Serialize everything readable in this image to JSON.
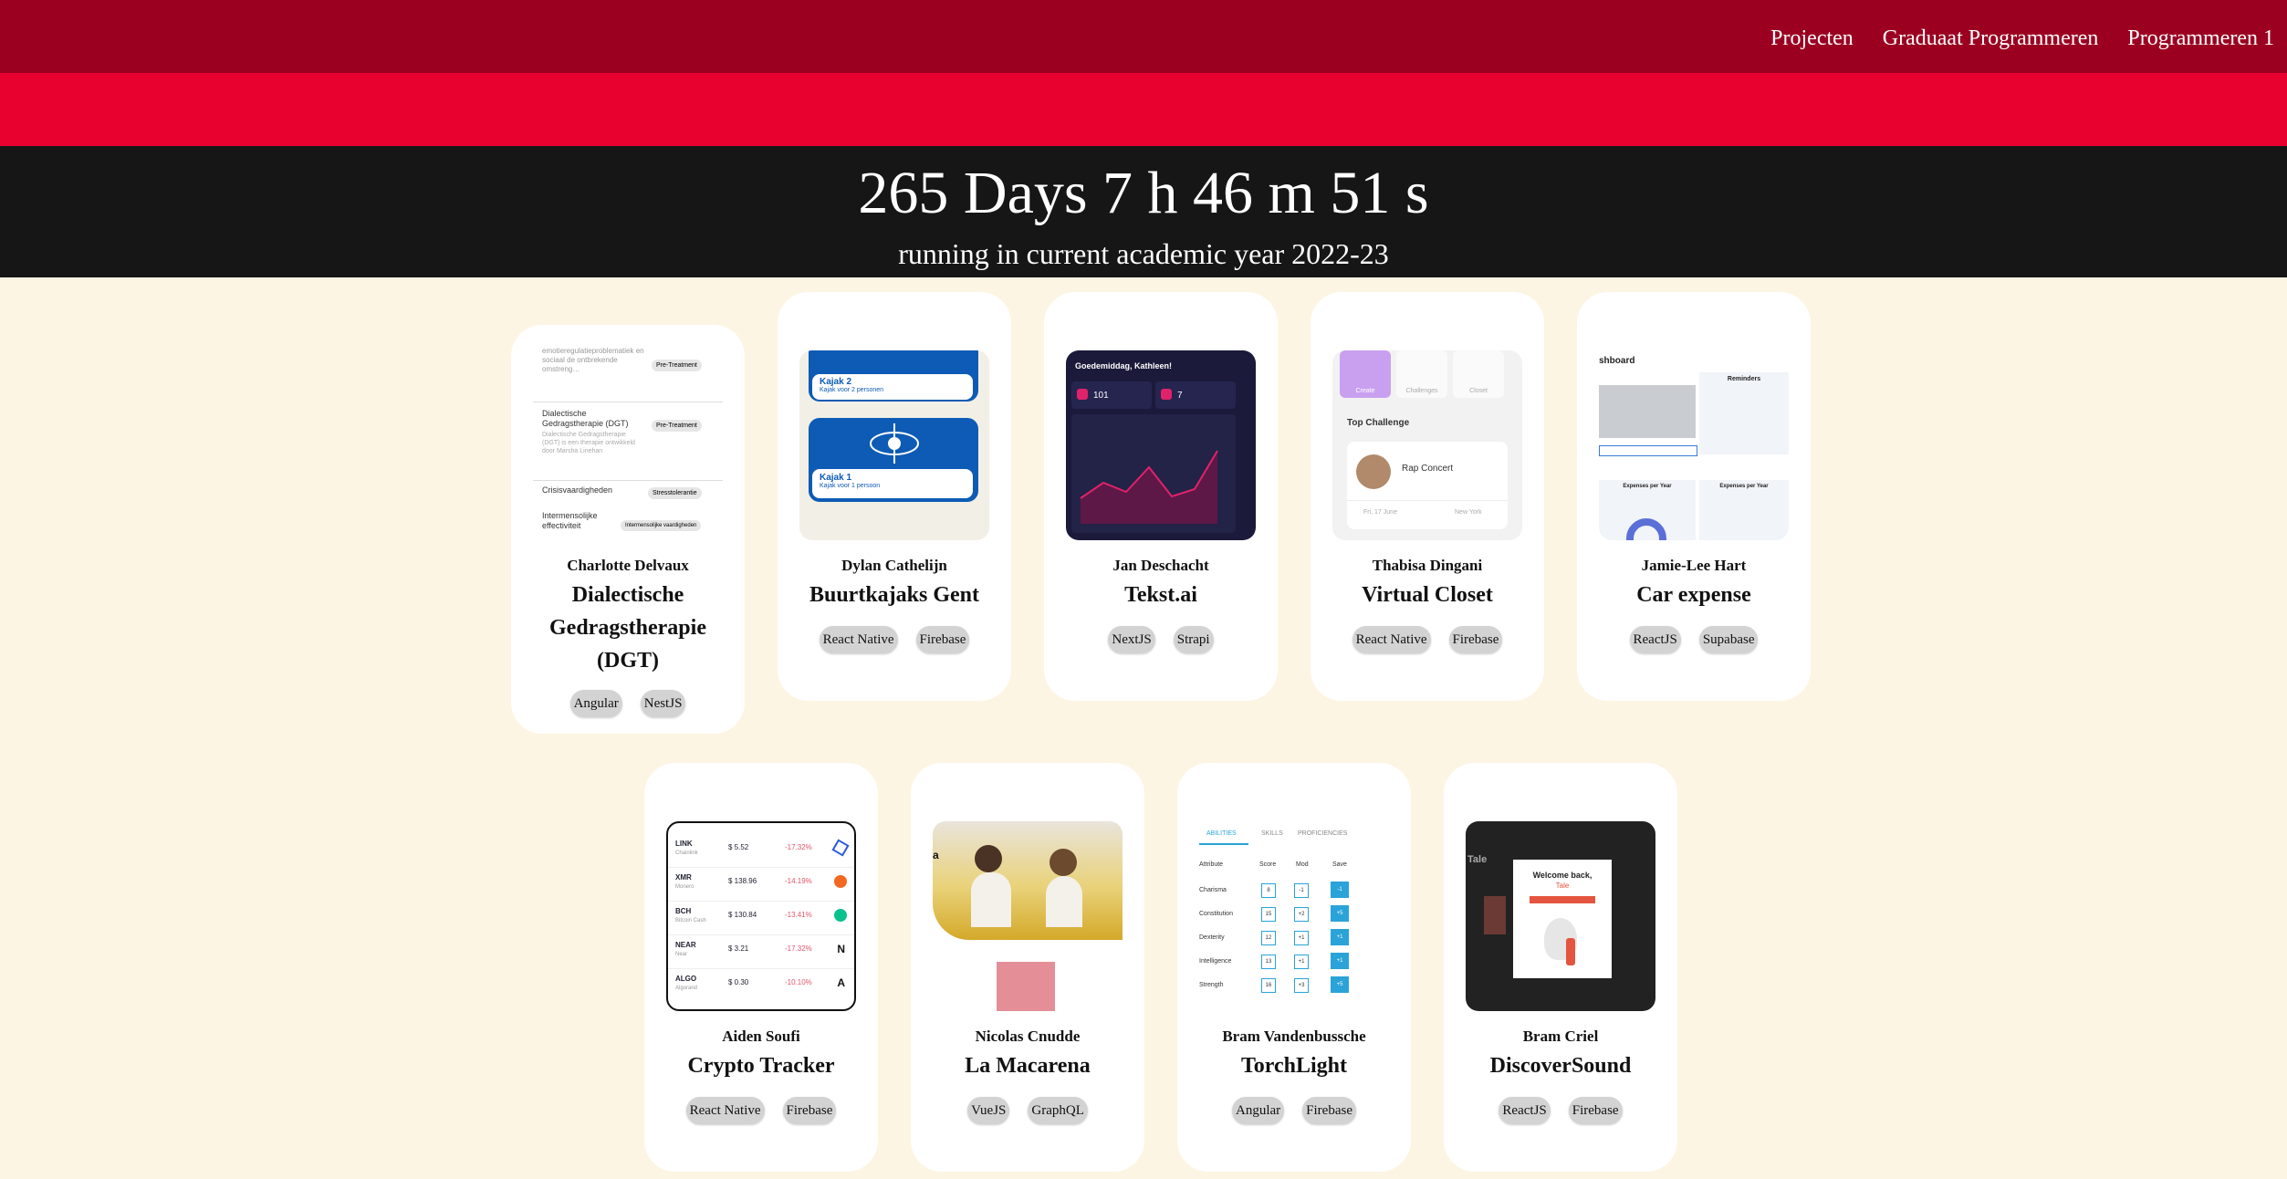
{
  "nav": {
    "items": [
      "Projecten",
      "Graduaat Programmeren",
      "Programmeren 1"
    ]
  },
  "hero": {
    "countdown": "265 Days 7 h 46 m 51 s",
    "subtitle": "running in current academic year 2022-23"
  },
  "projects": [
    {
      "author": "Charlotte Delvaux",
      "title": "Dialectische Gedragstherapie (DGT)",
      "tags": [
        "Angular",
        "NestJS"
      ],
      "preview": {
        "rows": [
          {
            "text": "emotieregulatieproblematiek en sociaal de ontbrekende omstreng…",
            "badge": "Pre-Treatment"
          },
          {
            "text": "Dialectische Gedragstherapie (DGT)",
            "badge": "Pre-Treatment"
          },
          {
            "text": "Crisisvaardigheden",
            "badge": "Stresstolerantie"
          },
          {
            "text": "Intermensolijke effectiviteit",
            "badge": "Intermensolijke vaardigheden"
          }
        ]
      }
    },
    {
      "author": "Dylan Cathelijn",
      "title": "Buurtkajaks Gent",
      "tags": [
        "React Native",
        "Firebase"
      ],
      "preview": {
        "items": [
          {
            "name": "Kajak 2",
            "sub": "Kajak voor 2 personen"
          },
          {
            "name": "Kajak 1",
            "sub": "Kajak voor 1 persoon"
          }
        ]
      }
    },
    {
      "author": "Jan Deschacht",
      "title": "Tekst.ai",
      "tags": [
        "NextJS",
        "Strapi"
      ],
      "preview": {
        "greeting": "Goedemiddag, Kathleen!",
        "stat1": "101",
        "stat2": "7"
      }
    },
    {
      "author": "Thabisa Dingani",
      "title": "Virtual Closet",
      "tags": [
        "React Native",
        "Firebase"
      ],
      "preview": {
        "tabs": [
          "Create",
          "Challenges",
          "Closet"
        ],
        "heading": "Top Challenge",
        "event": "Rap Concert",
        "date": "Fri, 17 June",
        "place": "New York"
      }
    },
    {
      "author": "Jamie-Lee Hart",
      "title": "Car expense",
      "tags": [
        "ReactJS",
        "Supabase"
      ],
      "preview": {
        "heading": "shboard",
        "reminders": "Reminders",
        "exp1": "Expenses per Year",
        "exp2": "Expenses per Year"
      }
    },
    {
      "author": "Aiden Soufi",
      "title": "Crypto Tracker",
      "tags": [
        "React Native",
        "Firebase"
      ],
      "preview": {
        "coins": [
          {
            "sym": "LINK",
            "name": "Chainlink",
            "price": "$ 5.52",
            "chg": "-17.32%"
          },
          {
            "sym": "XMR",
            "name": "Monero",
            "price": "$ 138.96",
            "chg": "-14.19%"
          },
          {
            "sym": "BCH",
            "name": "Bitcoin Cash",
            "price": "$ 130.84",
            "chg": "-13.41%"
          },
          {
            "sym": "NEAR",
            "name": "Near",
            "price": "$ 3.21",
            "chg": "-17.32%"
          },
          {
            "sym": "ALGO",
            "name": "Algorand",
            "price": "$ 0.30",
            "chg": "-10.10%"
          }
        ]
      }
    },
    {
      "author": "Nicolas Cnudde",
      "title": "La Macarena",
      "tags": [
        "VueJS",
        "GraphQL"
      ],
      "preview": {}
    },
    {
      "author": "Bram Vandenbussche",
      "title": "TorchLight",
      "tags": [
        "Angular",
        "Firebase"
      ],
      "preview": {
        "tabs": [
          "ABILITIES",
          "SKILLS",
          "PROFICIENCIES"
        ],
        "cols": [
          "Attribute",
          "Score",
          "Mod",
          "Save"
        ],
        "rows": [
          {
            "attr": "Charisma",
            "score": "8",
            "mod": "-1",
            "save": "-1"
          },
          {
            "attr": "Constitution",
            "score": "15",
            "mod": "+2",
            "save": "+5"
          },
          {
            "attr": "Dexterity",
            "score": "12",
            "mod": "+1",
            "save": "+1"
          },
          {
            "attr": "Intelligence",
            "score": "13",
            "mod": "+1",
            "save": "+1"
          },
          {
            "attr": "Strength",
            "score": "16",
            "mod": "+3",
            "save": "+5"
          }
        ]
      }
    },
    {
      "author": "Bram Criel",
      "title": "DiscoverSound",
      "tags": [
        "ReactJS",
        "Firebase"
      ],
      "preview": {
        "welcome": "Welcome back,",
        "name": "Tale",
        "side": "Tale"
      }
    }
  ],
  "colors": {
    "nav": "#9c0021",
    "band": "#e8002f",
    "hero": "#161616",
    "page": "#fdf5e3"
  }
}
